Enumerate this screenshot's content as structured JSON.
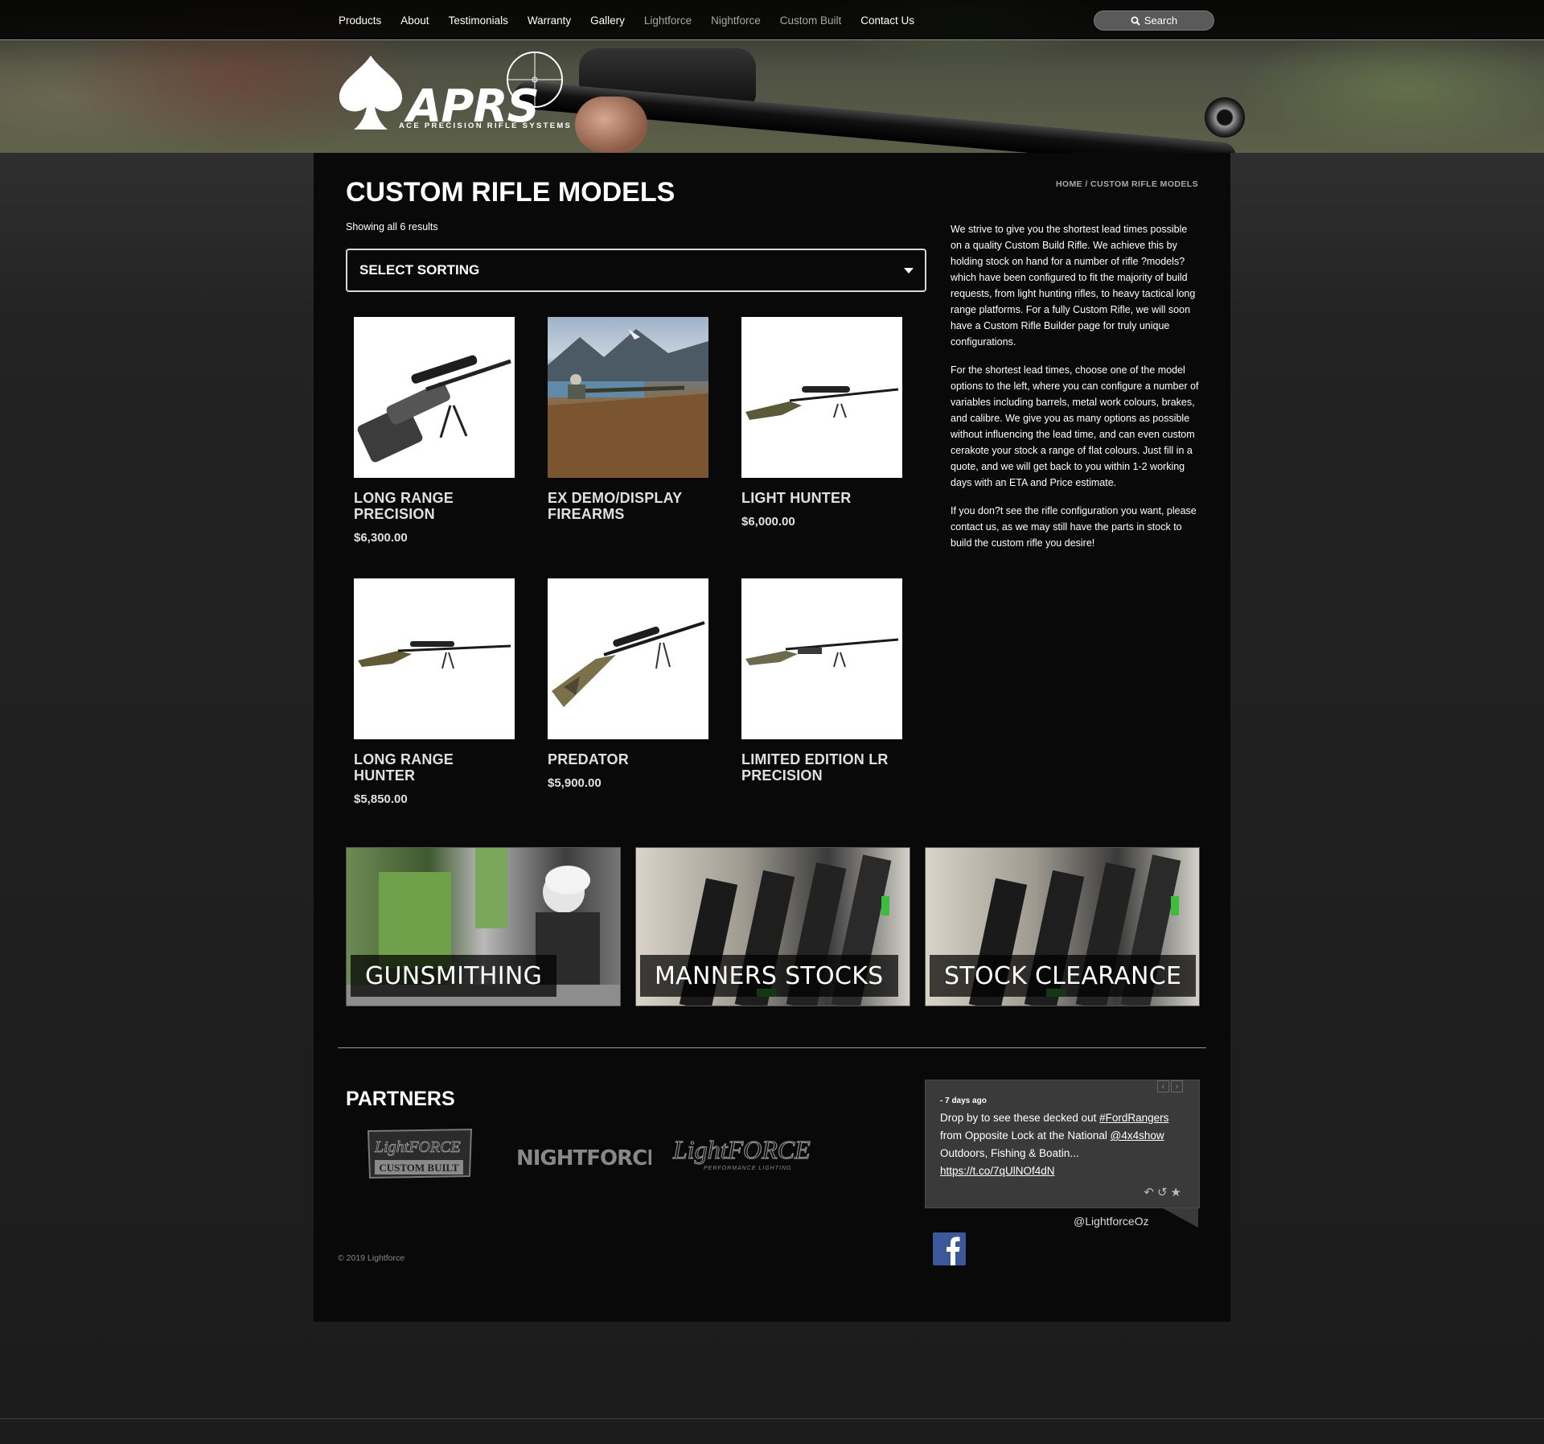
{
  "nav": {
    "items": [
      {
        "label": "Products",
        "dim": false
      },
      {
        "label": "About",
        "dim": false
      },
      {
        "label": "Testimonials",
        "dim": false
      },
      {
        "label": "Warranty",
        "dim": false
      },
      {
        "label": "Gallery",
        "dim": false
      },
      {
        "label": "Lightforce",
        "dim": true
      },
      {
        "label": "Nightforce",
        "dim": true
      },
      {
        "label": "Custom Built",
        "dim": true
      },
      {
        "label": "Contact Us",
        "dim": false
      }
    ],
    "search_label": "Search"
  },
  "logo": {
    "text": "APRS",
    "subtitle": "ACE PRECISION RIFLE SYSTEMS"
  },
  "page": {
    "title": "CUSTOM RIFLE MODELS",
    "breadcrumb": "HOME / CUSTOM RIFLE MODELS",
    "result_count": "Showing all 6 results",
    "sort_label": "SELECT SORTING"
  },
  "products": [
    {
      "name": "LONG RANGE PRECISION",
      "price": "$6,300.00"
    },
    {
      "name": "EX DEMO/DISPLAY FIREARMS",
      "price": ""
    },
    {
      "name": "LIGHT HUNTER",
      "price": "$6,000.00"
    },
    {
      "name": "LONG RANGE HUNTER",
      "price": "$5,850.00"
    },
    {
      "name": "PREDATOR",
      "price": "$5,900.00"
    },
    {
      "name": "LIMITED EDITION LR PRECISION",
      "price": ""
    }
  ],
  "sidebar": {
    "paragraphs": [
      "We strive to give you the shortest lead times possible on a quality Custom Build Rifle. We achieve this by holding stock on hand for a number of rifle ?models? which have been configured to fit the majority of build requests, from light hunting rifles, to heavy tactical long range platforms. For a fully Custom Rifle, we will soon have a Custom Rifle Builder page for truly unique configurations.",
      "For the shortest lead times, choose one of the model options to the left, where you can configure a number of variables including barrels, metal work colours, brakes, and calibre. We give you as many options as possible without influencing the lead time, and can even custom cerakote your stock a range of flat colours. Just fill in a quote, and we will get back to you within 1-2 working days with an ETA and Price estimate.",
      "If you don?t see the rifle configuration you want, please contact us, as we may still have the parts in stock to build the custom rifle you desire!"
    ]
  },
  "promos": [
    {
      "label": "GUNSMITHING"
    },
    {
      "label": "MANNERS STOCKS"
    },
    {
      "label": "STOCK CLEARANCE"
    }
  ],
  "partners": {
    "title": "PARTNERS",
    "logos": [
      "Lightforce Custom Built",
      "NIGHTFORCE",
      "Lightforce"
    ],
    "lightforce_badge_text": "CUSTOM BUILT",
    "lightforce_script": "LightFORCE",
    "lightforce_tagline": "PERFORMANCE LIGHTING",
    "nightforce_text": "NIGHTFORCE"
  },
  "tweet": {
    "meta": "- 7 days ago",
    "text_before": "Drop by to see these decked out ",
    "hashtag": "#FordRangers",
    "text_middle": " from Opposite Lock at the National ",
    "mention": "@4x4show",
    "text_after": " Outdoors, Fishing & Boatin...",
    "link": "https://t.co/7qUlNOf4dN",
    "handle": "@LightforceOz"
  },
  "footer": {
    "copyright": "© 2019 Lightforce"
  },
  "colors": {
    "background": "#232323",
    "content_bg": "#090909",
    "facebook": "#3b5998",
    "tweet_bg": "#3a3a3a"
  }
}
